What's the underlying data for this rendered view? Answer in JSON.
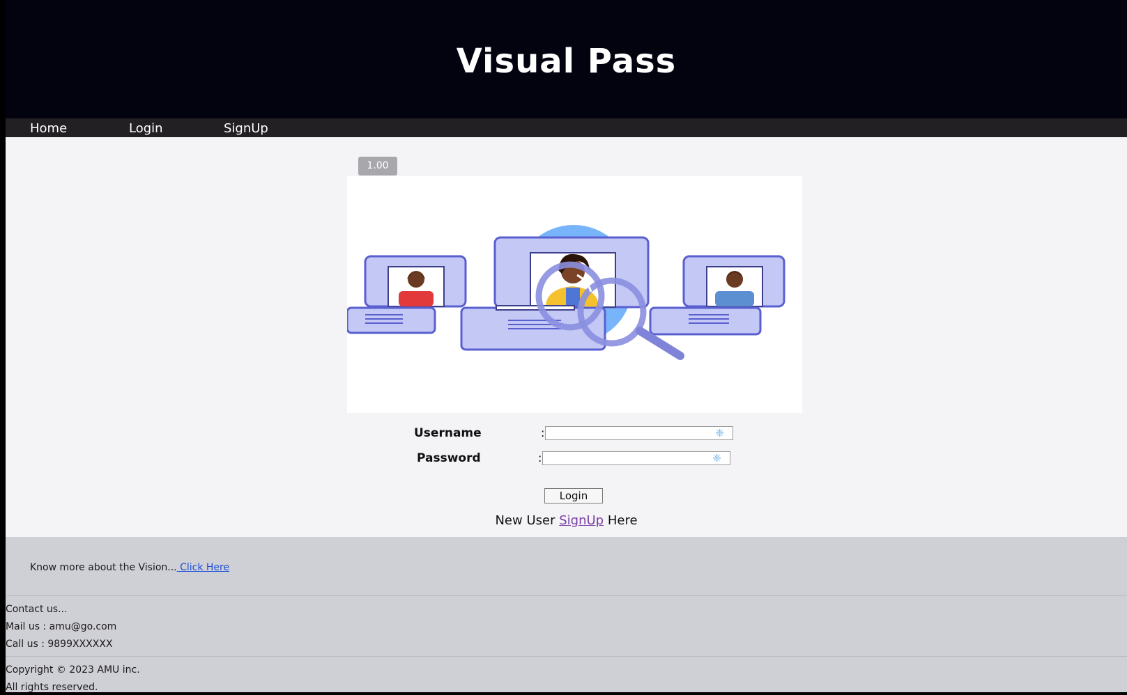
{
  "header": {
    "title": "Visual Pass"
  },
  "nav": {
    "items": [
      "Home",
      "Login",
      "SignUp"
    ]
  },
  "zoom_badge": "1.00",
  "form": {
    "username_label": "Username",
    "password_label": "Password",
    "separator": ":",
    "username_value": "",
    "password_value": "",
    "login_button": "Login",
    "signup_prefix": "New User",
    "signup_link": "SignUp",
    "signup_suffix": "Here"
  },
  "footer": {
    "vision_text": "Know more about the Vision...",
    "vision_link": " Click Here ",
    "contact_heading": "Contact us...",
    "mail": "Mail us : amu@go.com",
    "call": "Call us : 9899XXXXXX",
    "copyright": "Copyright © 2023 AMU inc.",
    "rights": "All rights reserved."
  },
  "colors": {
    "header_bg": "#03030f",
    "navbar_bg": "#222022",
    "footer_bg": "#cfcfd6",
    "link_blue": "#1d4fd6",
    "link_visited": "#7a3fa6"
  }
}
